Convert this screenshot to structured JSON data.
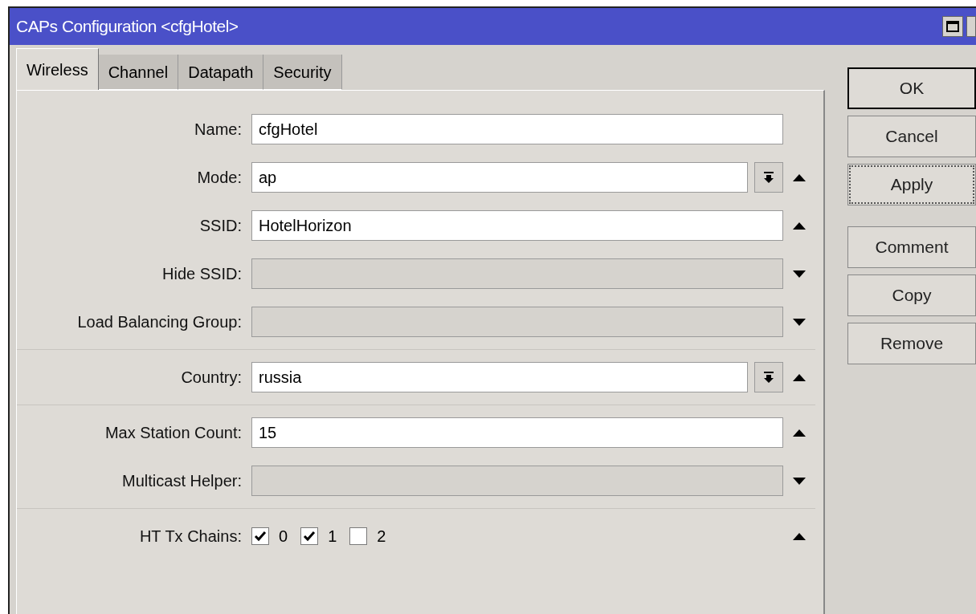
{
  "window": {
    "title": "CAPs Configuration <cfgHotel>"
  },
  "tabs": [
    {
      "label": "Wireless",
      "selected": true
    },
    {
      "label": "Channel",
      "selected": false
    },
    {
      "label": "Datapath",
      "selected": false
    },
    {
      "label": "Security",
      "selected": false
    }
  ],
  "sections": [
    [
      {
        "kind": "text",
        "label": "Name:",
        "value": "cfgHotel"
      },
      {
        "kind": "combo",
        "label": "Mode:",
        "value": "ap",
        "expanded": true
      },
      {
        "kind": "text",
        "label": "SSID:",
        "value": "HotelHorizon",
        "expanded": true
      },
      {
        "kind": "empty",
        "label": "Hide SSID:",
        "expanded": false
      },
      {
        "kind": "empty",
        "label": "Load Balancing Group:",
        "expanded": false
      }
    ],
    [
      {
        "kind": "combo",
        "label": "Country:",
        "value": "russia",
        "expanded": true
      }
    ],
    [
      {
        "kind": "text",
        "label": "Max Station Count:",
        "value": "15",
        "expanded": true
      },
      {
        "kind": "empty",
        "label": "Multicast Helper:",
        "expanded": false
      }
    ],
    [
      {
        "kind": "checks",
        "label": "HT Tx Chains:",
        "expanded": true,
        "options": [
          {
            "label": "0",
            "checked": true
          },
          {
            "label": "1",
            "checked": true
          },
          {
            "label": "2",
            "checked": false
          }
        ]
      }
    ]
  ],
  "buttons": [
    {
      "label": "OK",
      "kind": "default"
    },
    {
      "label": "Cancel",
      "kind": "plain"
    },
    {
      "label": "Apply",
      "kind": "focused"
    },
    {
      "label": "Comment",
      "kind": "gap"
    },
    {
      "label": "Copy",
      "kind": "plain"
    },
    {
      "label": "Remove",
      "kind": "plain"
    }
  ]
}
